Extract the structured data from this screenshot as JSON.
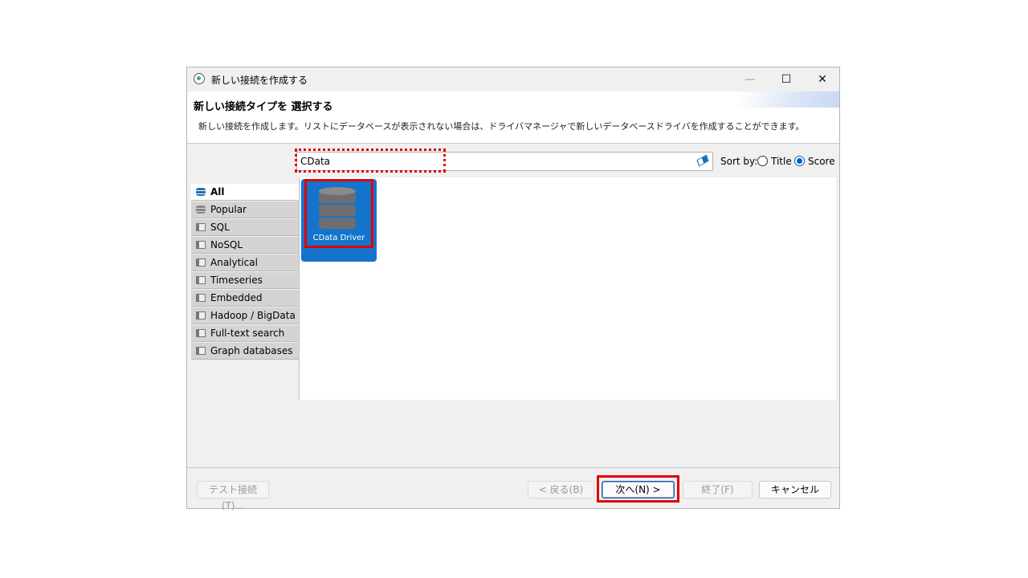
{
  "window": {
    "title": "新しい接続を作成する",
    "minimize": "—",
    "maximize": "☐",
    "close": "✕"
  },
  "header": {
    "title": "新しい接続タイプを 選択する",
    "description": "新しい接続を作成します。リストにデータベースが表示されない場合は、ドライバマネージャで新しいデータベースドライバを作成することができます。"
  },
  "search": {
    "value": "CData",
    "clear_icon": "eraser-icon"
  },
  "sort": {
    "label": "Sort by:",
    "options": [
      "Title",
      "Score"
    ],
    "selected": "Score"
  },
  "categories": [
    {
      "label": "All",
      "active": true,
      "icon": "database-icon"
    },
    {
      "label": "Popular",
      "active": false,
      "icon": "database-icon"
    },
    {
      "label": "SQL",
      "active": false,
      "icon": "folder-icon"
    },
    {
      "label": "NoSQL",
      "active": false,
      "icon": "folder-icon"
    },
    {
      "label": "Analytical",
      "active": false,
      "icon": "folder-icon"
    },
    {
      "label": "Timeseries",
      "active": false,
      "icon": "folder-icon"
    },
    {
      "label": "Embedded",
      "active": false,
      "icon": "folder-icon"
    },
    {
      "label": "Hadoop / BigData",
      "active": false,
      "icon": "folder-icon"
    },
    {
      "label": "Full-text search",
      "active": false,
      "icon": "folder-icon"
    },
    {
      "label": "Graph databases",
      "active": false,
      "icon": "folder-icon"
    }
  ],
  "drivers": [
    {
      "label": "CData Driver",
      "selected": true
    }
  ],
  "footer": {
    "test_connection": "テスト接続(T)...",
    "back": "< 戻る(B)",
    "next": "次へ(N) >",
    "finish": "終了(F)",
    "cancel": "キャンセル"
  },
  "colors": {
    "accent": "#1474cc",
    "highlight": "#e00000"
  }
}
